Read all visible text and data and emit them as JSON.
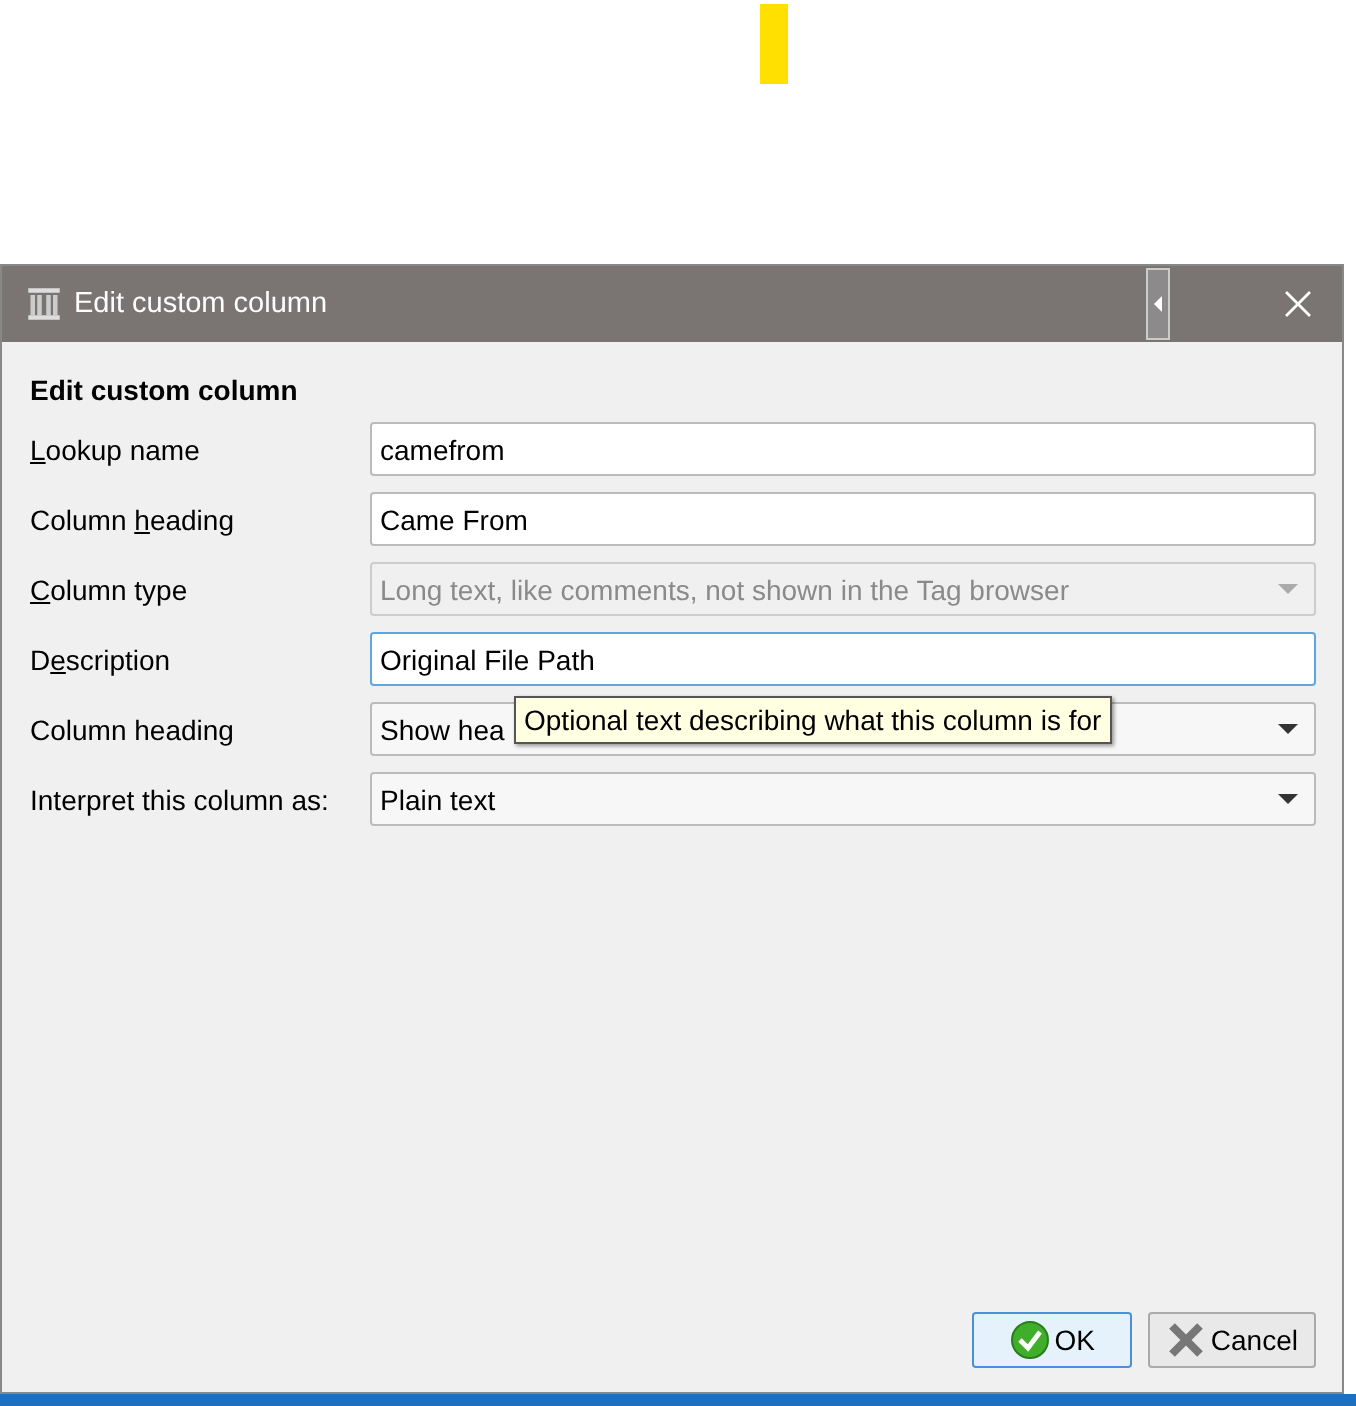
{
  "window": {
    "title": "Edit custom column"
  },
  "heading": "Edit custom column",
  "fields": [
    {
      "kind": "text",
      "label": [
        {
          "text": "L",
          "underlined": true
        },
        {
          "text": "ookup name",
          "underlined": false
        }
      ],
      "value": "camefrom",
      "disabled": false,
      "focused": false
    },
    {
      "kind": "text",
      "label": [
        {
          "text": "Column ",
          "underlined": false
        },
        {
          "text": "h",
          "underlined": true
        },
        {
          "text": "eading",
          "underlined": false
        }
      ],
      "value": "Came From",
      "disabled": false,
      "focused": false
    },
    {
      "kind": "select",
      "label": [
        {
          "text": "C",
          "underlined": true
        },
        {
          "text": "olumn type",
          "underlined": false
        }
      ],
      "value": "Long text, like comments, not shown in the Tag browser",
      "disabled": true,
      "focused": false
    },
    {
      "kind": "text",
      "label": [
        {
          "text": "D",
          "underlined": false
        },
        {
          "text": "e",
          "underlined": true
        },
        {
          "text": "scription",
          "underlined": false
        }
      ],
      "value": "Original File Path",
      "disabled": false,
      "focused": true
    },
    {
      "kind": "select",
      "label": [
        {
          "text": "Column heading",
          "underlined": false
        }
      ],
      "value": "Show hea",
      "disabled": false,
      "focused": false
    },
    {
      "kind": "select",
      "label": [
        {
          "text": "Interpret this column as:",
          "underlined": false
        }
      ],
      "value": "Plain text",
      "disabled": false,
      "focused": false
    }
  ],
  "tooltip": "Optional text describing what this column is for",
  "buttons": [
    {
      "kind": "ok",
      "label": "OK",
      "selected": true
    },
    {
      "kind": "cancel",
      "label": "Cancel",
      "selected": false
    }
  ]
}
